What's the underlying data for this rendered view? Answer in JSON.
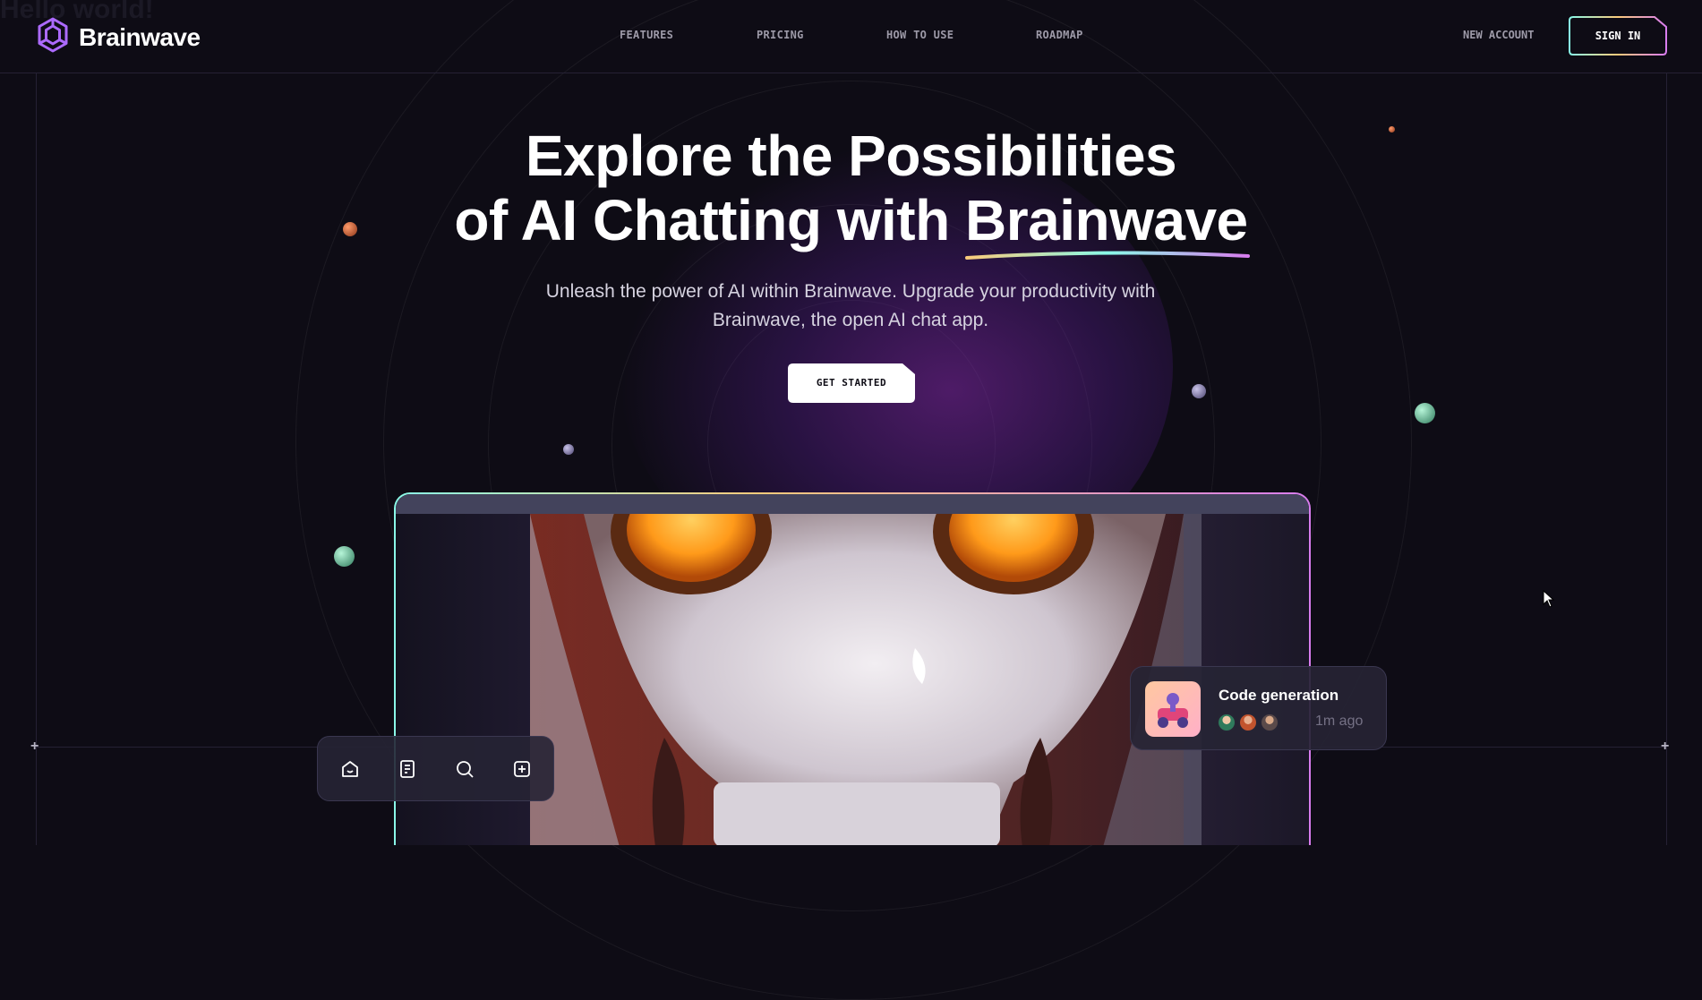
{
  "ghost_text": "Hello world!",
  "brand": {
    "name": "Brainwave",
    "accent": "#ac6aff"
  },
  "nav": {
    "items": [
      {
        "label": "FEATURES"
      },
      {
        "label": "PRICING"
      },
      {
        "label": "HOW TO USE"
      },
      {
        "label": "ROADMAP"
      }
    ],
    "new_account": "NEW ACCOUNT",
    "sign_in": "SIGN IN"
  },
  "hero": {
    "title_line1": "Explore the Possibilities",
    "title_line2_prefix": "of AI Chatting with ",
    "title_highlight": "Brainwave",
    "subtitle": "Unleash the power of AI within Brainwave. Upgrade your productivity with Brainwave, the open AI chat app.",
    "cta": "GET STARTED"
  },
  "toolbar": {
    "icons": [
      "home-icon",
      "document-icon",
      "search-icon",
      "add-square-icon"
    ]
  },
  "notification": {
    "title": "Code generation",
    "time": "1m ago"
  },
  "colors": {
    "background": "#0e0c15",
    "gradient_cyan": "#89f9e8",
    "gradient_yellow": "#facb7b",
    "gradient_pink": "#d87cee",
    "muted_text": "#9d9aa8"
  }
}
